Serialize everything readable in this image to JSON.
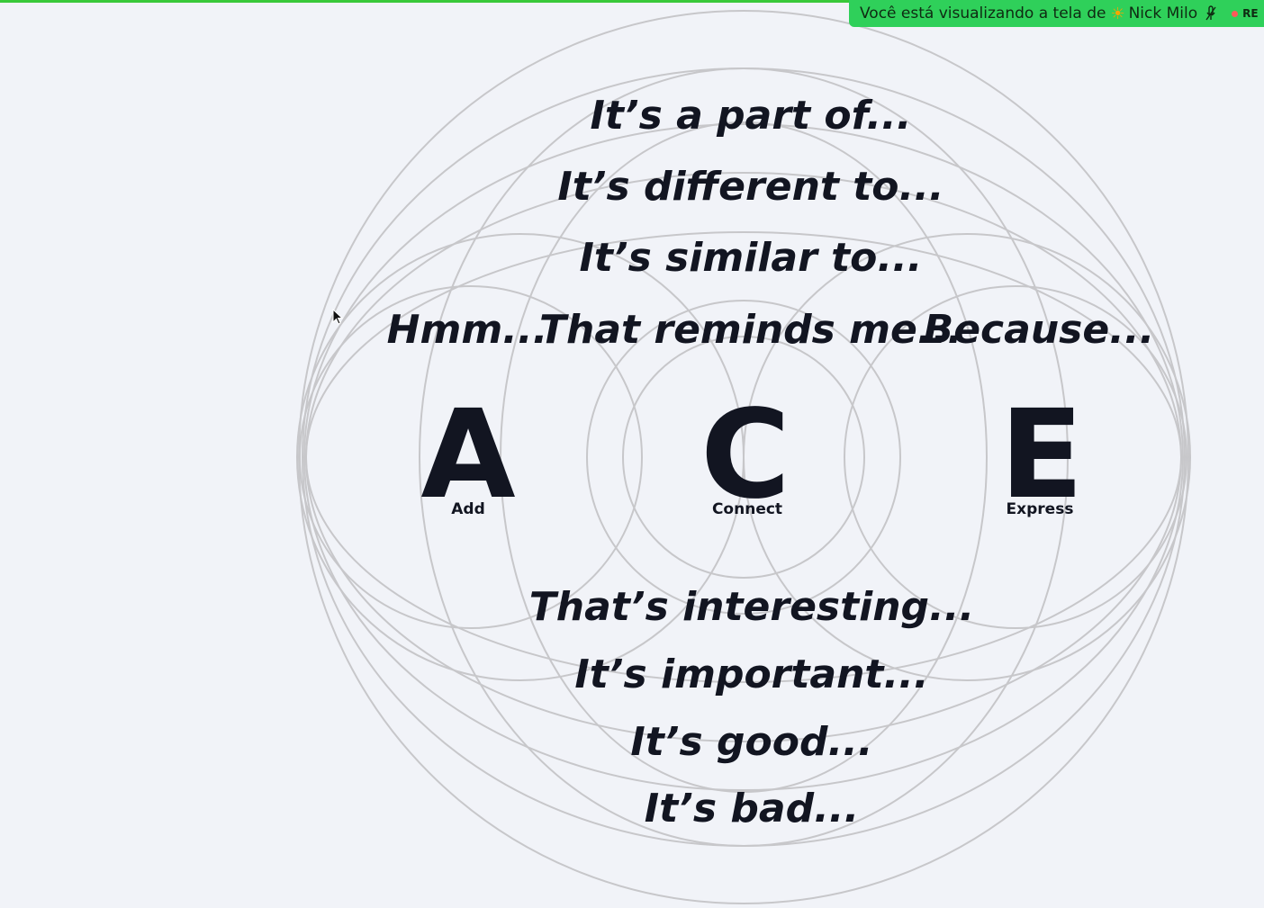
{
  "share_banner": {
    "prefix": "Você está visualizando a tela de",
    "sun_icon": "☀",
    "presenter": "Nick Milo",
    "rec_label": "RE",
    "color": "#2fd05a"
  },
  "diagram": {
    "top_phrases": [
      "It’s a part of...",
      "It’s different to...",
      "It’s similar to..."
    ],
    "row_phrases": {
      "left": "Hmm...",
      "center": "That reminds me...",
      "right": "Because..."
    },
    "letters": [
      {
        "letter": "A",
        "label": "Add"
      },
      {
        "letter": "C",
        "label": "Connect"
      },
      {
        "letter": "E",
        "label": "Express"
      }
    ],
    "bottom_phrases": [
      "That’s interesting...",
      "It’s important...",
      "It’s good...",
      "It’s bad..."
    ],
    "ink_color": "#121521",
    "circle_color": "#c7c7ca",
    "background": "#f1f3f8"
  }
}
